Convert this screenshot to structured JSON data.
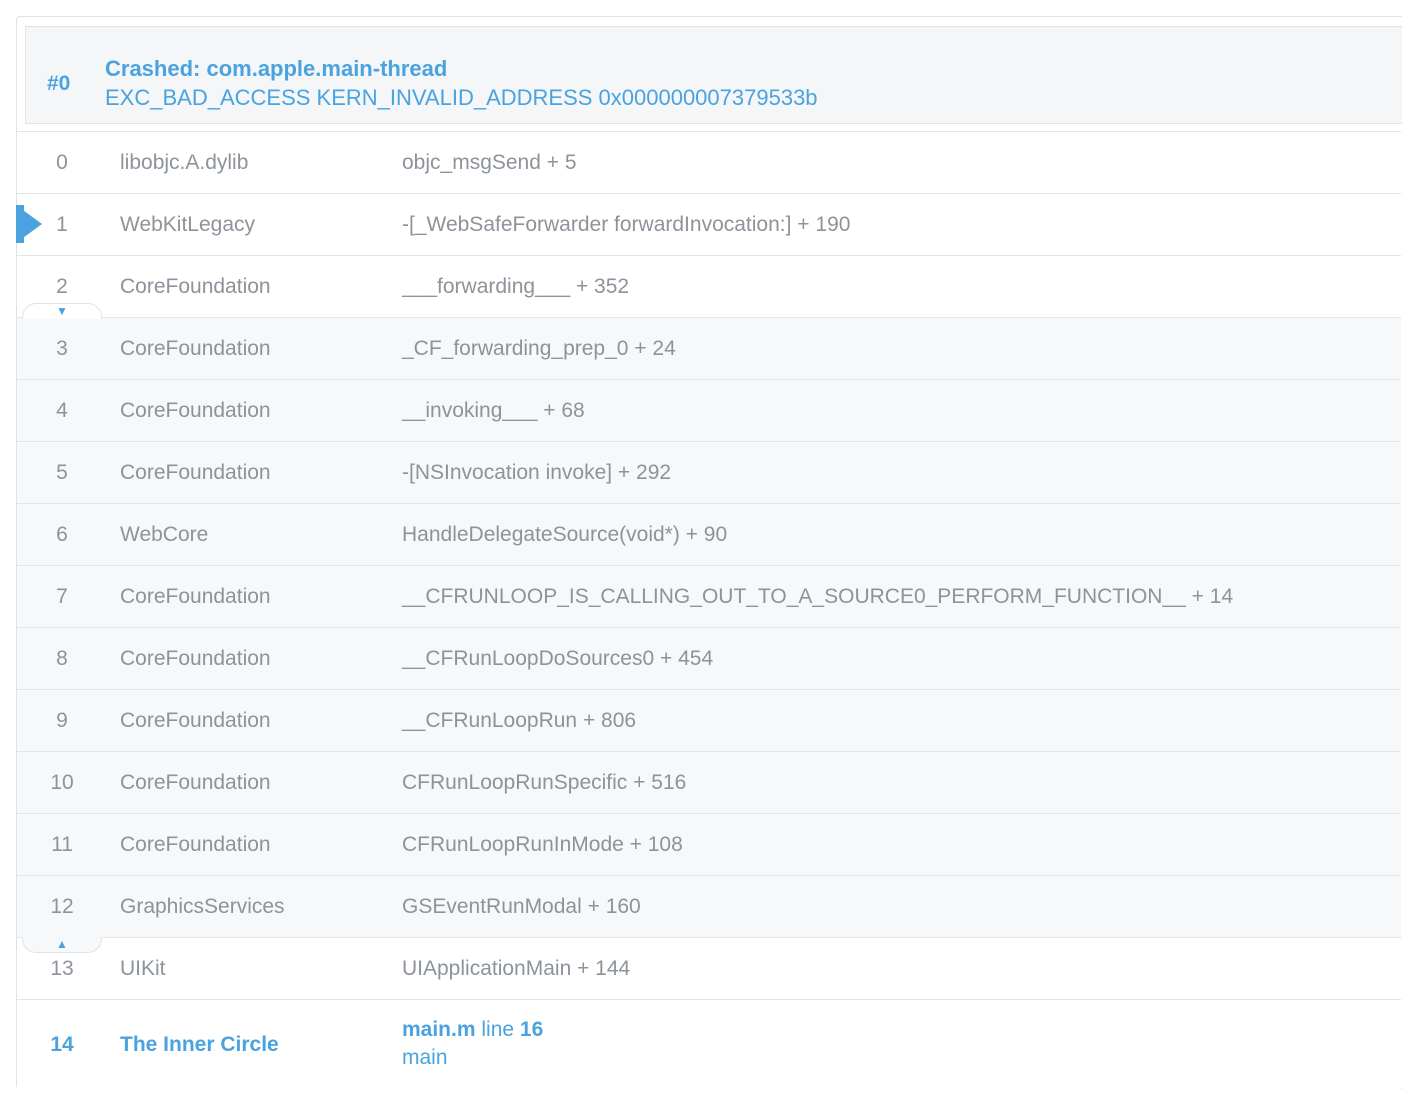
{
  "thread": {
    "number": "#0",
    "title": "Crashed: com.apple.main-thread",
    "reason": "EXC_BAD_ACCESS KERN_INVALID_ADDRESS 0x000000007379533b"
  },
  "frames": [
    {
      "num": "0",
      "lib": "libobjc.A.dylib",
      "symbol": "objc_msgSend + 5"
    },
    {
      "num": "1",
      "lib": "WebKitLegacy",
      "symbol": "-[_WebSafeForwarder forwardInvocation:] + 190"
    },
    {
      "num": "2",
      "lib": "CoreFoundation",
      "symbol": "___forwarding___ + 352"
    },
    {
      "num": "3",
      "lib": "CoreFoundation",
      "symbol": "_CF_forwarding_prep_0 + 24"
    },
    {
      "num": "4",
      "lib": "CoreFoundation",
      "symbol": "__invoking___ + 68"
    },
    {
      "num": "5",
      "lib": "CoreFoundation",
      "symbol": "-[NSInvocation invoke] + 292"
    },
    {
      "num": "6",
      "lib": "WebCore",
      "symbol": "HandleDelegateSource(void*) + 90"
    },
    {
      "num": "7",
      "lib": "CoreFoundation",
      "symbol": "__CFRUNLOOP_IS_CALLING_OUT_TO_A_SOURCE0_PERFORM_FUNCTION__ + 14"
    },
    {
      "num": "8",
      "lib": "CoreFoundation",
      "symbol": "__CFRunLoopDoSources0 + 454"
    },
    {
      "num": "9",
      "lib": "CoreFoundation",
      "symbol": "__CFRunLoopRun + 806"
    },
    {
      "num": "10",
      "lib": "CoreFoundation",
      "symbol": "CFRunLoopRunSpecific + 516"
    },
    {
      "num": "11",
      "lib": "CoreFoundation",
      "symbol": "CFRunLoopRunInMode + 108"
    },
    {
      "num": "12",
      "lib": "GraphicsServices",
      "symbol": "GSEventRunModal + 160"
    },
    {
      "num": "13",
      "lib": "UIKit",
      "symbol": "UIApplicationMain + 144"
    }
  ],
  "app_frame": {
    "num": "14",
    "lib": "The Inner Circle",
    "file": "main.m",
    "line_word": "line",
    "line": "16",
    "function": "main"
  },
  "toggles": {
    "collapse_down": "▼",
    "collapse_up": "▲"
  },
  "colors": {
    "accent": "#4aa3df",
    "text": "#8d939b",
    "border": "#e2e5e9",
    "header_bg": "#f4f6f8"
  }
}
